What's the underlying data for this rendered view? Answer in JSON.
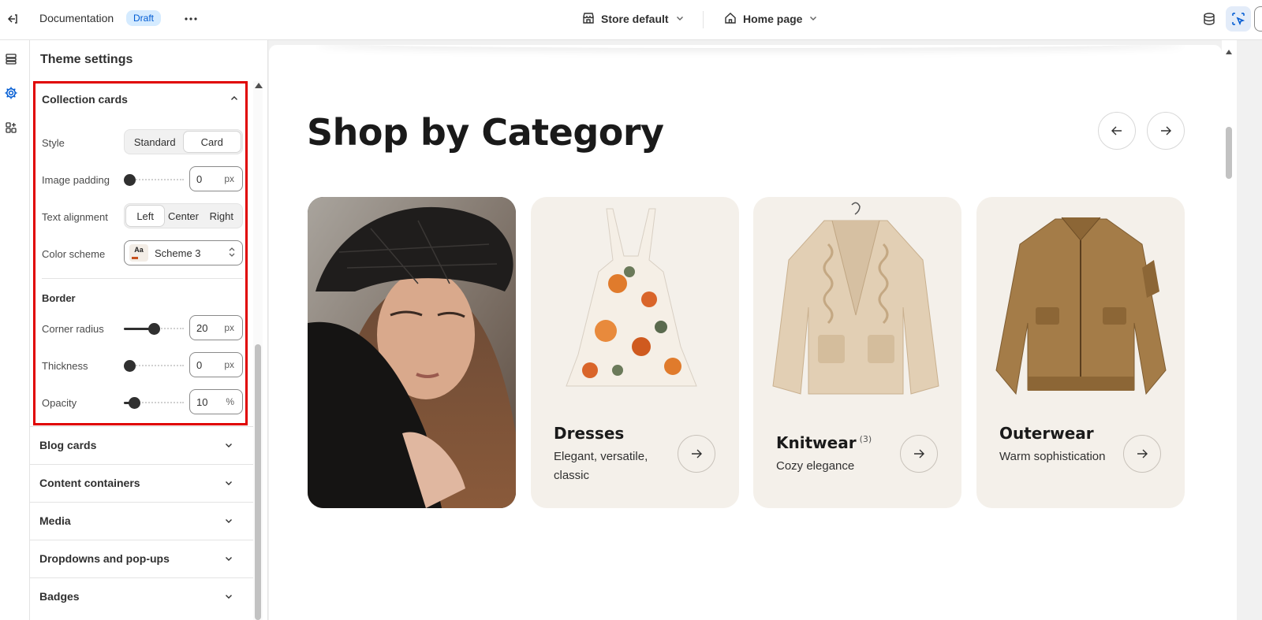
{
  "topbar": {
    "doc_title": "Documentation",
    "status_badge": "Draft",
    "store_selector": "Store default",
    "page_selector": "Home page"
  },
  "sidebar": {
    "title": "Theme settings",
    "collection_cards": {
      "heading": "Collection cards",
      "style_label": "Style",
      "style_options": [
        "Standard",
        "Card"
      ],
      "style_selected": "Card",
      "image_padding_label": "Image padding",
      "image_padding_value": "0",
      "image_padding_unit": "px",
      "text_alignment_label": "Text alignment",
      "text_alignment_options": [
        "Left",
        "Center",
        "Right"
      ],
      "text_alignment_selected": "Left",
      "color_scheme_label": "Color scheme",
      "color_scheme_swatch": "Aa",
      "color_scheme_value": "Scheme 3",
      "border_heading": "Border",
      "corner_radius_label": "Corner radius",
      "corner_radius_value": "20",
      "corner_radius_unit": "px",
      "thickness_label": "Thickness",
      "thickness_value": "0",
      "thickness_unit": "px",
      "opacity_label": "Opacity",
      "opacity_value": "10",
      "opacity_unit": "%"
    },
    "accordions": [
      "Blog cards",
      "Content containers",
      "Media",
      "Dropdowns and pop-ups",
      "Badges"
    ]
  },
  "preview": {
    "heading": "Shop by Category",
    "cards": [
      {
        "name": "",
        "count": "",
        "desc": ""
      },
      {
        "name": "Dresses",
        "count": "",
        "desc": "Elegant, versatile, classic"
      },
      {
        "name": "Knitwear",
        "count": "(3)",
        "desc": "Cozy elegance"
      },
      {
        "name": "Outerwear",
        "count": "",
        "desc": "Warm sophistication"
      }
    ]
  },
  "colors": {
    "accent": "#005bd3",
    "highlight_border": "#e00000",
    "card_bg": "#f4f0ea"
  }
}
